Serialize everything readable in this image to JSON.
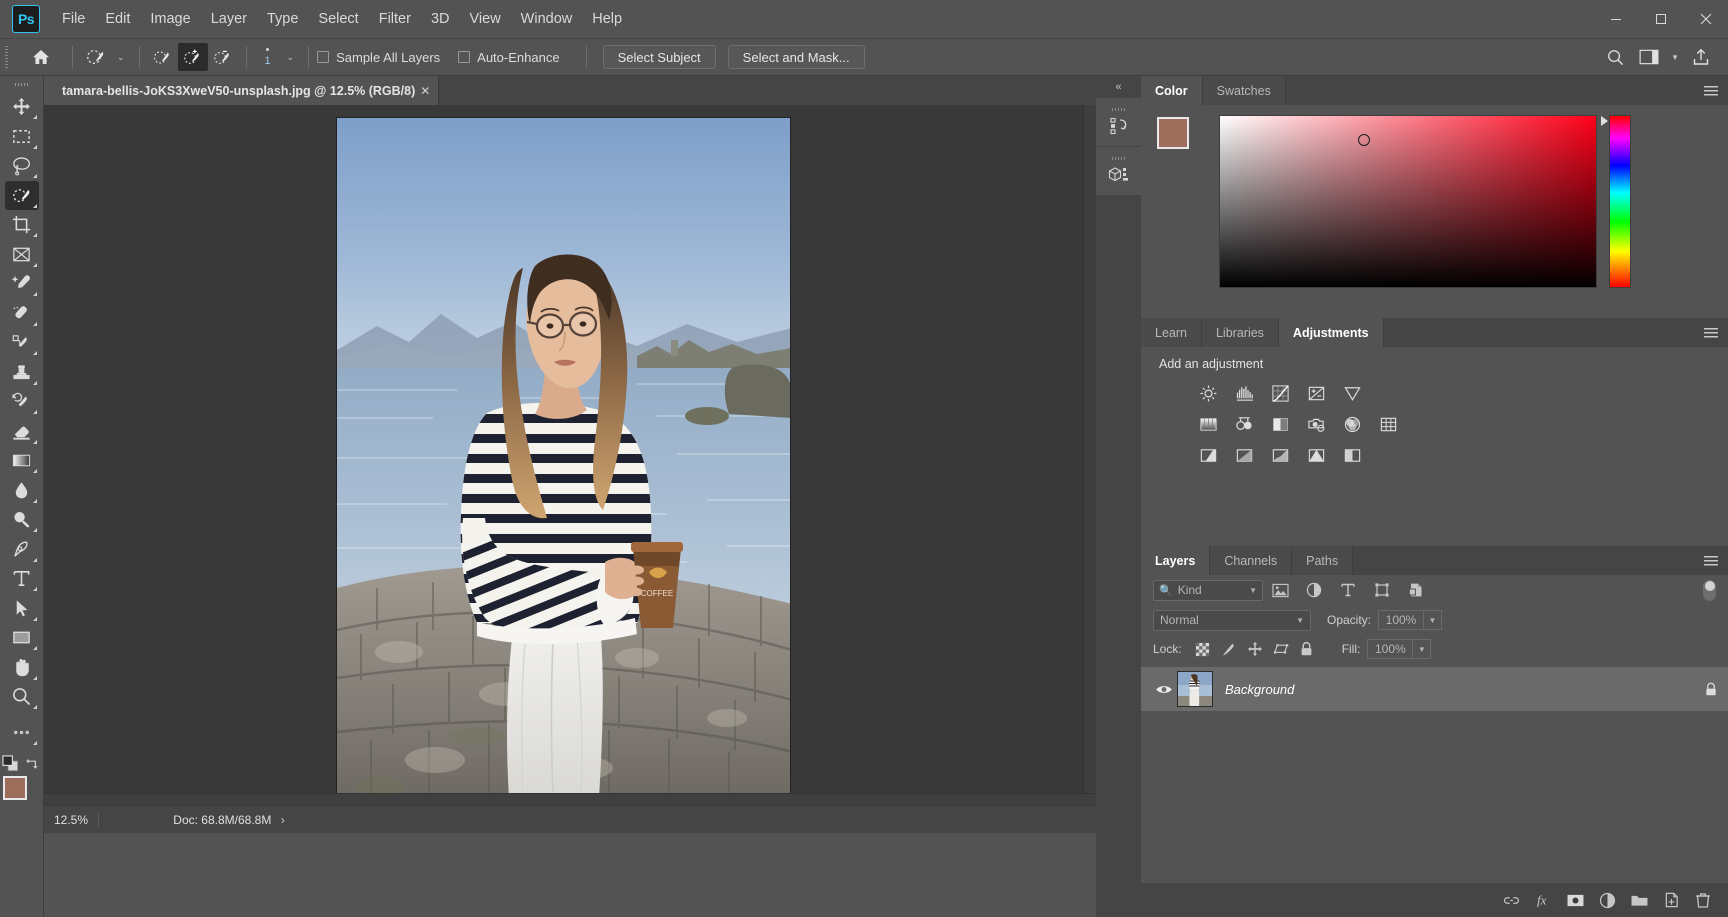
{
  "app": {
    "name": "Adobe Photoshop",
    "logo_text": "Ps",
    "accent_color": "#31c5f0",
    "ui_background": "#535353"
  },
  "menubar": {
    "items": [
      {
        "label": "File"
      },
      {
        "label": "Edit"
      },
      {
        "label": "Image"
      },
      {
        "label": "Layer"
      },
      {
        "label": "Type"
      },
      {
        "label": "Select"
      },
      {
        "label": "Filter"
      },
      {
        "label": "3D"
      },
      {
        "label": "View"
      },
      {
        "label": "Window"
      },
      {
        "label": "Help"
      }
    ],
    "window_controls": {
      "minimize": "—",
      "maximize": "❑",
      "close": "✕"
    }
  },
  "options_bar": {
    "home_icon": "home-icon",
    "tool_preset_icon": "quick-selection-preset-icon",
    "preset_caret": "⌄",
    "mode_new_icon": "selection-new-icon",
    "mode_add_icon": "selection-add-icon",
    "mode_subtract_icon": "selection-subtract-icon",
    "brush_size_label": "1",
    "brush_caret": "⌄",
    "sample_all_layers": {
      "label": "Sample All Layers",
      "checked": false
    },
    "auto_enhance": {
      "label": "Auto-Enhance",
      "checked": false
    },
    "select_subject": "Select Subject",
    "select_and_mask": "Select and Mask...",
    "right_icons": [
      "search-icon",
      "workspace-icon",
      "workspace-caret-icon",
      "share-icon"
    ]
  },
  "toolbar": {
    "tools": [
      {
        "name": "move-tool",
        "label": "Move Tool",
        "selected": false
      },
      {
        "name": "rectangular-marquee-tool",
        "label": "Rectangular Marquee Tool",
        "selected": false
      },
      {
        "name": "lasso-tool",
        "label": "Lasso Tool",
        "selected": false
      },
      {
        "name": "quick-selection-tool",
        "label": "Quick Selection Tool",
        "selected": true
      },
      {
        "name": "crop-tool",
        "label": "Crop Tool",
        "selected": false
      },
      {
        "name": "frame-tool",
        "label": "Frame Tool",
        "selected": false
      },
      {
        "name": "eyedropper-tool",
        "label": "Eyedropper Tool",
        "selected": false
      },
      {
        "name": "spot-healing-brush-tool",
        "label": "Spot Healing Brush Tool",
        "selected": false
      },
      {
        "name": "brush-tool",
        "label": "Brush Tool",
        "selected": false
      },
      {
        "name": "clone-stamp-tool",
        "label": "Clone Stamp Tool",
        "selected": false
      },
      {
        "name": "history-brush-tool",
        "label": "History Brush Tool",
        "selected": false
      },
      {
        "name": "eraser-tool",
        "label": "Eraser Tool",
        "selected": false
      },
      {
        "name": "gradient-tool",
        "label": "Gradient Tool",
        "selected": false
      },
      {
        "name": "blur-tool",
        "label": "Blur Tool",
        "selected": false
      },
      {
        "name": "dodge-tool",
        "label": "Dodge Tool",
        "selected": false
      },
      {
        "name": "pen-tool",
        "label": "Pen Tool",
        "selected": false
      },
      {
        "name": "type-tool",
        "label": "Horizontal Type Tool",
        "selected": false
      },
      {
        "name": "path-selection-tool",
        "label": "Path Selection Tool",
        "selected": false
      },
      {
        "name": "rectangle-tool",
        "label": "Rectangle Tool",
        "selected": false
      },
      {
        "name": "hand-tool",
        "label": "Hand Tool",
        "selected": false
      },
      {
        "name": "zoom-tool",
        "label": "Zoom Tool",
        "selected": false
      },
      {
        "name": "edit-toolbar-tool",
        "label": "Edit Toolbar",
        "selected": false
      }
    ],
    "foreground_color": "#9e6e5c",
    "background_color": "#f2b9bd",
    "swap_colors_icon": "swap-colors-icon",
    "default_colors_icon": "default-colors-icon"
  },
  "document": {
    "tab_title": "tamara-bellis-JoKS3XweV50-unsplash.jpg @ 12.5% (RGB/8)",
    "close_glyph": "✕"
  },
  "status_bar": {
    "zoom_level": "12.5%",
    "doc_info": "Doc: 68.8M/68.8M",
    "expand_glyph": "›"
  },
  "panel_rail": {
    "collapse_glyph": "«",
    "buttons": [
      {
        "name": "history-panel-rail-button",
        "icon": "history-icon"
      },
      {
        "name": "3d-panel-rail-button",
        "icon": "cube-icon"
      }
    ]
  },
  "color_panel": {
    "tabs": [
      {
        "label": "Color",
        "active": true
      },
      {
        "label": "Swatches",
        "active": false
      }
    ],
    "menu_icon": "panel-menu-icon",
    "foreground_color": "#9e6e5c",
    "background_color": "#f0b6ba",
    "picker_marker": "color-picker-ring"
  },
  "adjustments_panel": {
    "tabs": [
      {
        "label": "Learn",
        "active": false
      },
      {
        "label": "Libraries",
        "active": false
      },
      {
        "label": "Adjustments",
        "active": true
      }
    ],
    "menu_icon": "panel-menu-icon",
    "heading": "Add an adjustment",
    "rows": [
      [
        "brightness-contrast-icon",
        "levels-icon",
        "curves-icon",
        "exposure-icon",
        "vibrance-icon"
      ],
      [
        "hue-saturation-icon",
        "color-balance-icon",
        "black-white-icon",
        "photo-filter-icon",
        "channel-mixer-icon",
        "color-lookup-icon"
      ],
      [
        "invert-icon",
        "posterize-icon",
        "threshold-icon",
        "gradient-map-icon",
        "selective-color-icon"
      ]
    ]
  },
  "layers_panel": {
    "tabs": [
      {
        "label": "Layers",
        "active": true
      },
      {
        "label": "Channels",
        "active": false
      },
      {
        "label": "Paths",
        "active": false
      }
    ],
    "menu_icon": "panel-menu-icon",
    "filter": {
      "kind_label": "Kind",
      "search_icon": "search-icon",
      "caret": "⌄",
      "type_filters": [
        "pixel-filter-icon",
        "adjustment-filter-icon",
        "type-filter-icon",
        "shape-filter-icon",
        "smart-object-filter-icon"
      ],
      "toggle_name": "filter-enable-toggle"
    },
    "blend_mode": "Normal",
    "blend_caret": "⌄",
    "opacity_label": "Opacity:",
    "opacity_value": "100%",
    "lock_label": "Lock:",
    "lock_icons": [
      "lock-transparent-pixels-icon",
      "lock-image-pixels-icon",
      "lock-position-icon",
      "lock-artboard-icon",
      "lock-all-icon"
    ],
    "fill_label": "Fill:",
    "fill_value": "100%",
    "layers": [
      {
        "name": "Background",
        "visible": true,
        "locked": true,
        "visibility_icon": "eye-icon",
        "lock_icon": "lock-icon",
        "thumbnail": "layer-thumbnail"
      }
    ],
    "footer_icons": [
      {
        "name": "link-layers-button",
        "icon": "link-icon"
      },
      {
        "name": "layer-style-button",
        "icon": "fx-icon"
      },
      {
        "name": "add-layer-mask-button",
        "icon": "mask-icon"
      },
      {
        "name": "new-fill-adjustment-button",
        "icon": "half-circle-icon"
      },
      {
        "name": "new-group-button",
        "icon": "folder-icon"
      },
      {
        "name": "new-layer-button",
        "icon": "new-layer-icon"
      },
      {
        "name": "delete-layer-button",
        "icon": "trash-icon"
      }
    ]
  },
  "canvas": {
    "image_alt": "Woman in striped sweater holding coffee cup by waterfront stone wall",
    "background_color": "#393939"
  }
}
